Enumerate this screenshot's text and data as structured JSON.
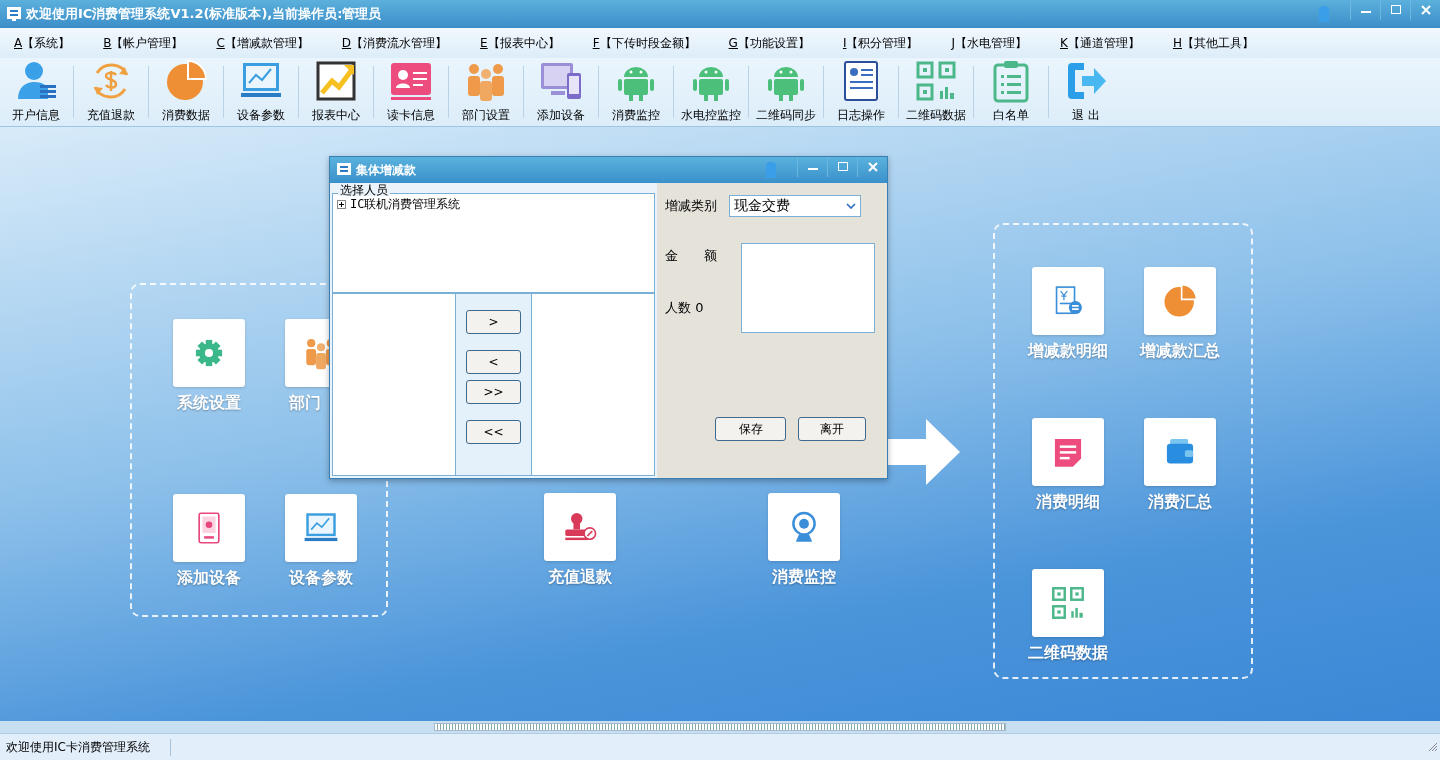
{
  "window": {
    "title": "欢迎使用IC消费管理系统V1.2(标准版本),当前操作员:管理员"
  },
  "menu": [
    {
      "key": "A",
      "label": "【系统】"
    },
    {
      "key": "B",
      "label": "【帐户管理】"
    },
    {
      "key": "C",
      "label": "【增减款管理】"
    },
    {
      "key": "D",
      "label": "【消费流水管理】"
    },
    {
      "key": "E",
      "label": "【报表中心】"
    },
    {
      "key": "F",
      "label": "【下传时段金额】"
    },
    {
      "key": "G",
      "label": "【功能设置】"
    },
    {
      "key": "I",
      "label": "【积分管理】"
    },
    {
      "key": "J",
      "label": "【水电管理】"
    },
    {
      "key": "K",
      "label": "【通道管理】"
    },
    {
      "key": "H",
      "label": "【其他工具】"
    }
  ],
  "toolbar": [
    "开户信息",
    "充值退款",
    "消费数据",
    "设备参数",
    "报表中心",
    "读卡信息",
    "部门设置",
    "添加设备",
    "消费监控",
    "水电控监控",
    "二维码同步",
    "日志操作",
    "二维码数据",
    "白名单",
    "退 出"
  ],
  "workspace": {
    "left_group": [
      "系统设置",
      "部门",
      "添加设备",
      "设备参数"
    ],
    "middle": [
      "充值退款",
      "消费监控"
    ],
    "right_group": [
      "增减款明细",
      "增减款汇总",
      "消费明细",
      "消费汇总",
      "二维码数据"
    ]
  },
  "dialog": {
    "title": "集体增减款",
    "group_label": "选择人员",
    "tree": [
      {
        "label": "IC联机消费管理系统",
        "expanded": false
      }
    ],
    "move_buttons": [
      ">",
      "<",
      ">>",
      "<<"
    ],
    "type_label": "增减类别",
    "type_value": "现金交费",
    "amount_label": "金　　额",
    "count_label": "人数 0",
    "buttons": [
      "保存",
      "离开"
    ]
  },
  "status_bar": {
    "text": "欢迎使用IC卡消费管理系统"
  }
}
